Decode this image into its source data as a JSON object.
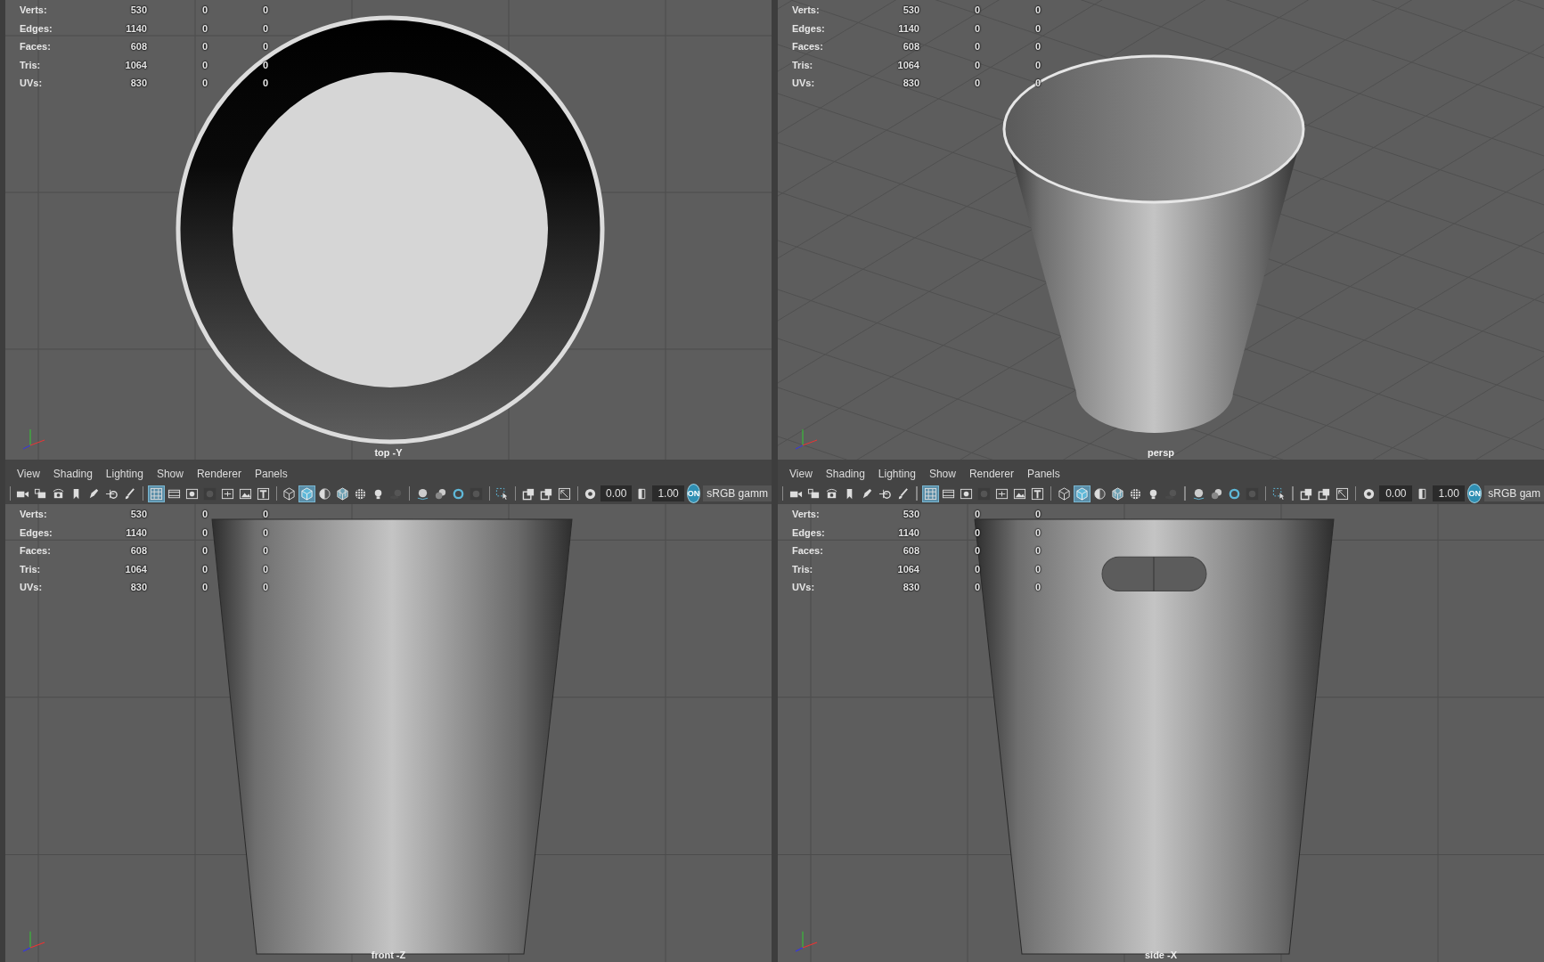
{
  "viewports": [
    {
      "kind": "top",
      "label": "top -Y",
      "stats": [
        {
          "label": "Verts:",
          "values": [
            "530",
            "0",
            "0"
          ]
        },
        {
          "label": "Edges:",
          "values": [
            "1140",
            "0",
            "0"
          ]
        },
        {
          "label": "Faces:",
          "values": [
            "608",
            "0",
            "0"
          ]
        },
        {
          "label": "Tris:",
          "values": [
            "1064",
            "0",
            "0"
          ]
        },
        {
          "label": "UVs:",
          "values": [
            "830",
            "0",
            "0"
          ]
        }
      ]
    },
    {
      "kind": "persp",
      "label": "persp",
      "stats": [
        {
          "label": "Verts:",
          "values": [
            "530",
            "0",
            "0"
          ]
        },
        {
          "label": "Edges:",
          "values": [
            "1140",
            "0",
            "0"
          ]
        },
        {
          "label": "Faces:",
          "values": [
            "608",
            "0",
            "0"
          ]
        },
        {
          "label": "Tris:",
          "values": [
            "1064",
            "0",
            "0"
          ]
        },
        {
          "label": "UVs:",
          "values": [
            "830",
            "0",
            "0"
          ]
        }
      ]
    },
    {
      "kind": "front",
      "label": "front -Z",
      "menu": [
        "View",
        "Shading",
        "Lighting",
        "Show",
        "Renderer",
        "Panels"
      ],
      "toolbar": [
        {
          "kind": "separator"
        },
        {
          "kind": "camera",
          "selected": false
        },
        {
          "kind": "camera-frame",
          "selected": false
        },
        {
          "kind": "camera-eye",
          "selected": false
        },
        {
          "kind": "bookmark",
          "selected": false
        },
        {
          "kind": "pen",
          "selected": false
        },
        {
          "kind": "move",
          "selected": false
        },
        {
          "kind": "brush",
          "selected": false
        },
        {
          "kind": "separator"
        },
        {
          "kind": "grid",
          "selected": true
        },
        {
          "kind": "film",
          "selected": false
        },
        {
          "kind": "circle-square",
          "selected": false
        },
        {
          "kind": "shaded-square",
          "selected": false
        },
        {
          "kind": "frame",
          "selected": false
        },
        {
          "kind": "image",
          "selected": false
        },
        {
          "kind": "text-box",
          "selected": false
        },
        {
          "kind": "separator"
        },
        {
          "kind": "cube-wire",
          "selected": false
        },
        {
          "kind": "cube-shaded",
          "selected": true
        },
        {
          "kind": "half-circle",
          "selected": false
        },
        {
          "kind": "cube-textured",
          "selected": false
        },
        {
          "kind": "checker",
          "selected": false
        },
        {
          "kind": "bulb",
          "selected": false
        },
        {
          "kind": "shadow",
          "selected": false
        },
        {
          "kind": "separator"
        },
        {
          "kind": "sphere",
          "selected": false
        },
        {
          "kind": "two-spheres",
          "selected": false
        },
        {
          "kind": "ring",
          "selected": false
        },
        {
          "kind": "shaded-square",
          "selected": false
        },
        {
          "kind": "separator"
        },
        {
          "kind": "select-arrow",
          "selected": false
        },
        {
          "kind": "separator"
        },
        {
          "kind": "overlap",
          "selected": false
        },
        {
          "kind": "overlap",
          "selected": false
        },
        {
          "kind": "resize",
          "selected": false
        },
        {
          "kind": "separator"
        },
        {
          "kind": "aperture",
          "selected": false
        },
        {
          "kind": "field",
          "value": "0.00"
        },
        {
          "kind": "half-square",
          "selected": false
        },
        {
          "kind": "field",
          "value": "1.00"
        },
        {
          "kind": "toggle",
          "text": "ON"
        },
        {
          "kind": "dropdown",
          "text": "sRGB gamm"
        }
      ],
      "stats": [
        {
          "label": "Verts:",
          "values": [
            "530",
            "0",
            "0"
          ]
        },
        {
          "label": "Edges:",
          "values": [
            "1140",
            "0",
            "0"
          ]
        },
        {
          "label": "Faces:",
          "values": [
            "608",
            "0",
            "0"
          ]
        },
        {
          "label": "Tris:",
          "values": [
            "1064",
            "0",
            "0"
          ]
        },
        {
          "label": "UVs:",
          "values": [
            "830",
            "0",
            "0"
          ]
        }
      ]
    },
    {
      "kind": "side",
      "label": "side -X",
      "menu": [
        "View",
        "Shading",
        "Lighting",
        "Show",
        "Renderer",
        "Panels"
      ],
      "toolbar": [
        {
          "kind": "separator"
        },
        {
          "kind": "camera",
          "selected": false
        },
        {
          "kind": "camera-frame",
          "selected": false
        },
        {
          "kind": "camera-eye",
          "selected": false
        },
        {
          "kind": "bookmark",
          "selected": false
        },
        {
          "kind": "pen",
          "selected": false
        },
        {
          "kind": "move",
          "selected": false
        },
        {
          "kind": "brush",
          "selected": false
        },
        {
          "kind": "separator"
        },
        {
          "kind": "grid",
          "selected": true
        },
        {
          "kind": "film",
          "selected": false
        },
        {
          "kind": "circle-square",
          "selected": false
        },
        {
          "kind": "shaded-square",
          "selected": false
        },
        {
          "kind": "frame",
          "selected": false
        },
        {
          "kind": "image",
          "selected": false
        },
        {
          "kind": "text-box",
          "selected": false
        },
        {
          "kind": "separator"
        },
        {
          "kind": "cube-wire",
          "selected": false
        },
        {
          "kind": "cube-shaded",
          "selected": true
        },
        {
          "kind": "half-circle",
          "selected": false
        },
        {
          "kind": "cube-textured",
          "selected": false
        },
        {
          "kind": "checker",
          "selected": false
        },
        {
          "kind": "bulb",
          "selected": false
        },
        {
          "kind": "shadow",
          "selected": false
        },
        {
          "kind": "separator"
        },
        {
          "kind": "sphere",
          "selected": false
        },
        {
          "kind": "two-spheres",
          "selected": false
        },
        {
          "kind": "ring",
          "selected": false
        },
        {
          "kind": "shaded-square",
          "selected": false
        },
        {
          "kind": "separator"
        },
        {
          "kind": "select-arrow",
          "selected": false
        },
        {
          "kind": "separator"
        },
        {
          "kind": "overlap",
          "selected": false
        },
        {
          "kind": "overlap",
          "selected": false
        },
        {
          "kind": "resize",
          "selected": false
        },
        {
          "kind": "separator"
        },
        {
          "kind": "aperture",
          "selected": false
        },
        {
          "kind": "field",
          "value": "0.00"
        },
        {
          "kind": "half-square",
          "selected": false
        },
        {
          "kind": "field",
          "value": "1.00"
        },
        {
          "kind": "toggle",
          "text": "ON"
        },
        {
          "kind": "dropdown",
          "text": "sRGB gam"
        }
      ],
      "stats": [
        {
          "label": "Verts:",
          "values": [
            "530",
            "0",
            "0"
          ]
        },
        {
          "label": "Edges:",
          "values": [
            "1140",
            "0",
            "0"
          ]
        },
        {
          "label": "Faces:",
          "values": [
            "608",
            "0",
            "0"
          ]
        },
        {
          "label": "Tris:",
          "values": [
            "1064",
            "0",
            "0"
          ]
        },
        {
          "label": "UVs:",
          "values": [
            "830",
            "0",
            "0"
          ]
        }
      ]
    }
  ]
}
